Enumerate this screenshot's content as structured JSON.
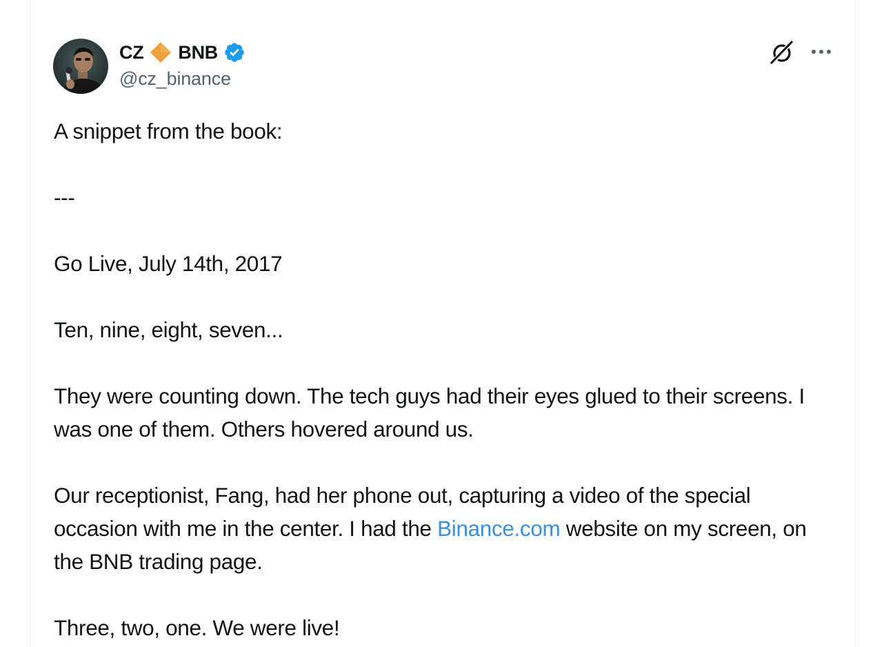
{
  "author": {
    "name_first": "CZ",
    "name_second": "BNB",
    "handle": "@cz_binance",
    "avatar_icon": "person-with-microphone-avatar",
    "verified_icon": "verified-badge-icon",
    "diamond_icon": "orange-diamond-icon"
  },
  "actions": {
    "grok_icon": "grok-icon",
    "more_icon": "more-options-icon"
  },
  "colors": {
    "text": "#0f1419",
    "secondary": "#536471",
    "link": "#3b8fe0",
    "verified": "#1d9bf0",
    "diamond": "#f0a03a"
  },
  "body": {
    "p1": "A snippet from the book:",
    "p2": "---",
    "p3": "Go Live, July 14th, 2017",
    "p4": "Ten, nine, eight, seven...",
    "p5": "They were counting down. The tech guys had their eyes glued to their screens. I was one of them. Others hovered around us.",
    "p6_before": "Our receptionist, Fang, had her phone out, capturing a video of the special occasion with me in the center. I had the ",
    "p6_link": "Binance.com",
    "p6_after": " website on my screen, on the BNB trading page.",
    "p7": "Three, two, one. We were live!"
  }
}
